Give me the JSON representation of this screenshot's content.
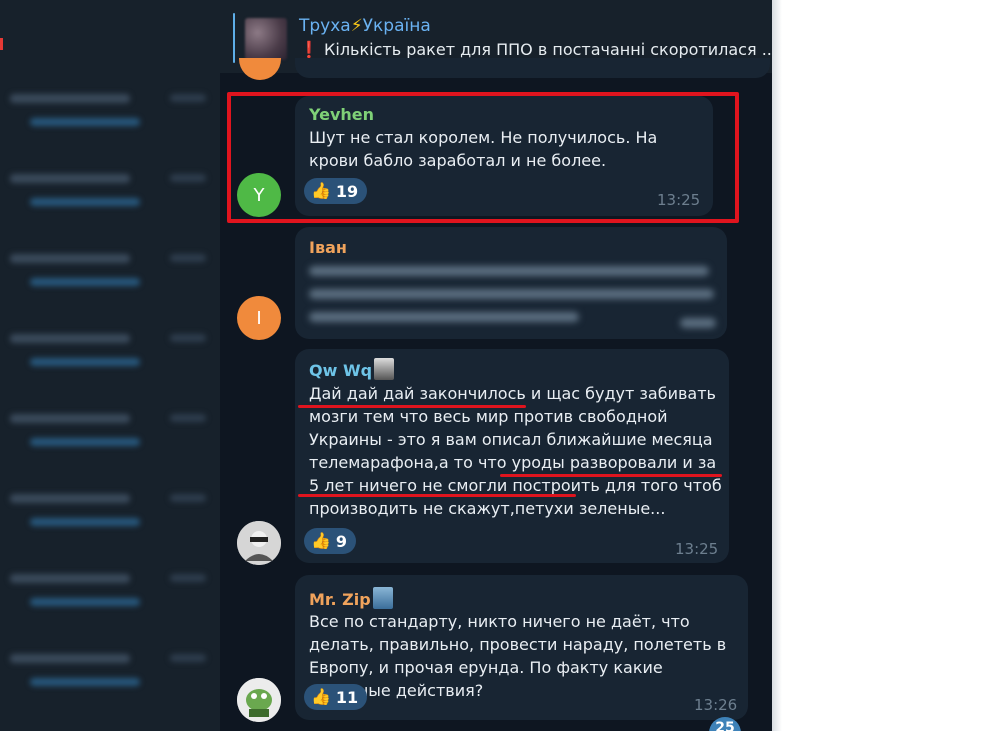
{
  "pinned": {
    "channel_title": "Труха",
    "channel_title_suffix": "Україна",
    "bolt_icon": "⚡",
    "message": "Кількість ракет для ППО в постачанні скоротилася ...",
    "warning_icon": "❗"
  },
  "messages": [
    {
      "sender": "Yevhen",
      "avatar_letter": "Y",
      "avatar_color": "#4fb946",
      "sender_color": "#7fd177",
      "text": "Шут не стал королем. Не получилось. На крови бабло заработал и не более.",
      "reaction_icon": "👍",
      "reaction_count": "19",
      "time": "13:25"
    },
    {
      "sender": "Іван",
      "avatar_letter": "І",
      "avatar_color": "#f08a3c",
      "sender_color": "#f0a35c",
      "text_blurred": true
    },
    {
      "sender": "Qw Wq",
      "sender_color": "#6ec4e8",
      "text": "Дай дай дай закончилось и щас будут  забивать мозги  тем что весь мир против свободной Украины - это я вам описал ближайшие месяца телемарафона,а то что уроды разворовали и за 5 лет ничего не смогли построить для того чтоб производить не скажут,петухи зеленые...",
      "reaction_icon": "👍",
      "reaction_count": "9",
      "time": "13:25"
    },
    {
      "sender": "Mr. Zip",
      "sender_color": "#f0a35c",
      "text": "Все по стандарту, никто ничего не даёт, что делать, правильно, провести нараду, полететь в Европу, и прочая ерунда. По факту какие полезные действия?",
      "reaction_icon": "👍",
      "reaction_count": "11",
      "time": "13:26"
    }
  ],
  "unread_badge": "25",
  "colors": {
    "chat_bg": "#0e1621",
    "bubble_bg": "#182533",
    "highlight_red": "#e0141e",
    "link_blue": "#6ab2f2"
  }
}
